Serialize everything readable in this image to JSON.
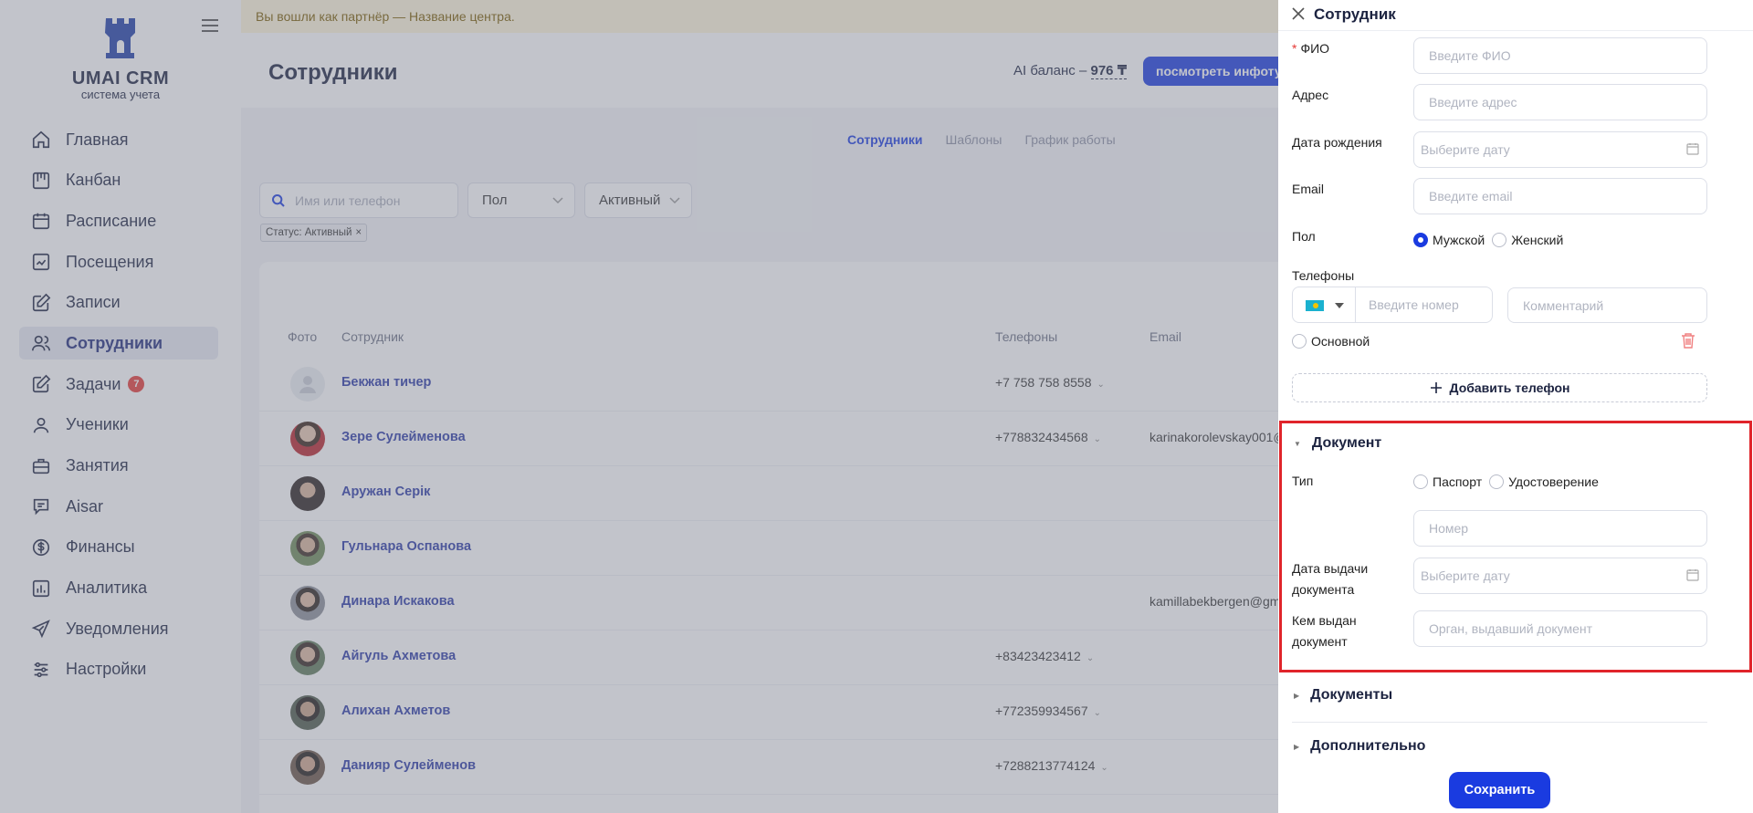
{
  "app": {
    "logo_title": "UMAI CRM",
    "logo_subtitle": "система учета"
  },
  "sidebar": {
    "items": [
      {
        "label": "Главная",
        "icon": "home-icon"
      },
      {
        "label": "Канбан",
        "icon": "kanban-icon"
      },
      {
        "label": "Расписание",
        "icon": "calendar-icon"
      },
      {
        "label": "Посещения",
        "icon": "chart-check-icon"
      },
      {
        "label": "Записи",
        "icon": "edit-icon"
      },
      {
        "label": "Сотрудники",
        "icon": "users-icon",
        "active": true
      },
      {
        "label": "Задачи",
        "icon": "task-icon",
        "badge": "7"
      },
      {
        "label": "Ученики",
        "icon": "user-icon"
      },
      {
        "label": "Занятия",
        "icon": "briefcase-icon"
      },
      {
        "label": "Aisar",
        "icon": "chat-icon"
      },
      {
        "label": "Финансы",
        "icon": "dollar-icon"
      },
      {
        "label": "Аналитика",
        "icon": "bar-chart-icon"
      },
      {
        "label": "Уведомления",
        "icon": "send-icon"
      },
      {
        "label": "Настройки",
        "icon": "sliders-icon"
      }
    ]
  },
  "partner_bar": "Вы вошли как партнёр — Название центра.",
  "header": {
    "title": "Сотрудники",
    "ai_balance_label": "AI баланс –",
    "ai_balance_value": "976 ₸",
    "info_button": "посмотреть инфотур"
  },
  "tabs": [
    {
      "label": "Сотрудники",
      "active": true
    },
    {
      "label": "Шаблоны"
    },
    {
      "label": "График работы"
    }
  ],
  "filters": {
    "search_placeholder": "Имя или телефон",
    "gender": "Пол",
    "status": "Активный",
    "chip": "Статус: Активный"
  },
  "table": {
    "columns": [
      "Фото",
      "Сотрудник",
      "Телефоны",
      "Email"
    ],
    "rows": [
      {
        "name": "Бекжан тичер",
        "phone": "+7 758 758 8558",
        "email": ""
      },
      {
        "name": "Зере Сулейменова",
        "phone": "+778832434568",
        "email": "karinakorolevskay001@"
      },
      {
        "name": "Аружан Серік",
        "phone": "",
        "email": ""
      },
      {
        "name": "Гульнара Оспанова",
        "phone": "",
        "email": ""
      },
      {
        "name": "Динара Искакова",
        "phone": "",
        "email": "kamillabekbergen@gm"
      },
      {
        "name": "Айгуль Ахметова",
        "phone": "+83423423412",
        "email": ""
      },
      {
        "name": "Алихан Ахметов",
        "phone": "+772359934567",
        "email": ""
      },
      {
        "name": "Данияр Сулейменов",
        "phone": "+7288213774124",
        "email": ""
      }
    ]
  },
  "drawer": {
    "title": "Сотрудник",
    "fio_label": "ФИО",
    "fio_placeholder": "Введите ФИО",
    "address_label": "Адрес",
    "address_placeholder": "Введите адрес",
    "birth_label": "Дата рождения",
    "birth_placeholder": "Выберите дату",
    "email_label": "Email",
    "email_placeholder": "Введите email",
    "gender_label": "Пол",
    "gender_male": "Мужской",
    "gender_female": "Женский",
    "phones_label": "Телефоны",
    "phone_placeholder": "Введите номер",
    "comment_placeholder": "Комментарий",
    "main_label": "Основной",
    "add_phone": "Добавить телефон",
    "document_section": "Документ",
    "type_label": "Тип",
    "type_passport": "Паспорт",
    "type_id": "Удостоверение",
    "number_placeholder": "Номер",
    "issue_date_label_1": "Дата выдачи",
    "issue_date_label_2": "документа",
    "issue_date_placeholder": "Выберите дату",
    "issued_by_label_1": "Кем выдан",
    "issued_by_label_2": "документ",
    "issued_by_placeholder": "Орган, выдавший документ",
    "documents_section": "Документы",
    "additional_section": "Дополнительно",
    "save": "Сохранить"
  },
  "colors": {
    "primary": "#1a3be0",
    "highlight_border": "#e0242a",
    "badge": "#e53935"
  }
}
